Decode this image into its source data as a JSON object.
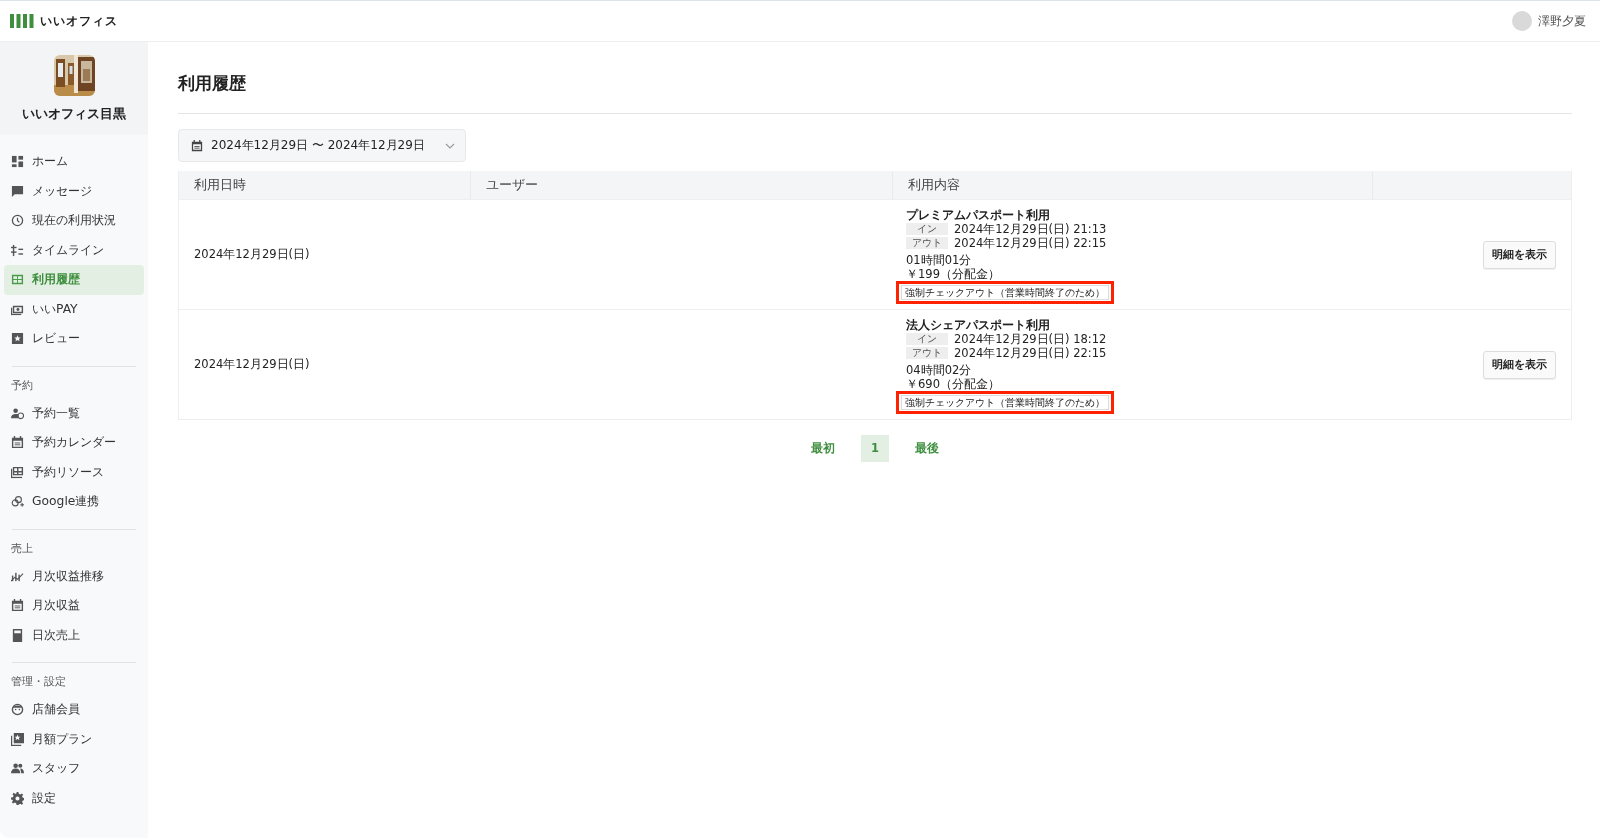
{
  "app": {
    "name": "いいオフィス"
  },
  "user": {
    "name": "澤野夕夏"
  },
  "store": {
    "name": "いいオフィス目黒"
  },
  "sidebar": {
    "sections": [
      {
        "items": [
          {
            "label": "ホーム",
            "selected": false
          },
          {
            "label": "メッセージ",
            "selected": false
          },
          {
            "label": "現在の利用状況",
            "selected": false
          },
          {
            "label": "タイムライン",
            "selected": false
          },
          {
            "label": "利用履歴",
            "selected": true
          },
          {
            "label": "いいPAY",
            "selected": false
          },
          {
            "label": "レビュー",
            "selected": false
          }
        ]
      },
      {
        "heading": "予約",
        "items": [
          {
            "label": "予約一覧",
            "selected": false
          },
          {
            "label": "予約カレンダー",
            "selected": false
          },
          {
            "label": "予約リソース",
            "selected": false
          },
          {
            "label": "Google連携",
            "selected": false
          }
        ]
      },
      {
        "heading": "売上",
        "items": [
          {
            "label": "月次収益推移",
            "selected": false
          },
          {
            "label": "月次収益",
            "selected": false
          },
          {
            "label": "日次売上",
            "selected": false
          }
        ]
      },
      {
        "heading": "管理・設定",
        "items": [
          {
            "label": "店舗会員",
            "selected": false
          },
          {
            "label": "月額プラン",
            "selected": false
          },
          {
            "label": "スタッフ",
            "selected": false
          },
          {
            "label": "設定",
            "selected": false
          }
        ]
      }
    ]
  },
  "page": {
    "title": "利用履歴"
  },
  "date_filter": {
    "value": "2024年12月29日 〜 2024年12月29日"
  },
  "table": {
    "columns": [
      "利用日時",
      "ユーザー",
      "利用内容"
    ],
    "rows": [
      {
        "date": "2024年12月29日(日)",
        "plan": "プレミアムパスポート利用",
        "in_label": "イン",
        "in_time": "2024年12月29日(日) 21:13",
        "out_label": "アウト",
        "out_time": "2024年12月29日(日) 22:15",
        "duration": "01時間01分",
        "amount": "￥199（分配金）",
        "notice": "強制チェックアウト（営業時間終了のため）",
        "highlighted": true,
        "button": "明細を表示"
      },
      {
        "date": "2024年12月29日(日)",
        "plan": "法人シェアパスポート利用",
        "in_label": "イン",
        "in_time": "2024年12月29日(日) 18:12",
        "out_label": "アウト",
        "out_time": "2024年12月29日(日) 22:15",
        "duration": "04時間02分",
        "amount": "￥690（分配金）",
        "notice": "強制チェックアウト（営業時間終了のため）",
        "highlighted": true,
        "button": "明細を表示"
      }
    ]
  },
  "pagination": [
    {
      "label": "最初",
      "selected": false
    },
    {
      "label": "1",
      "selected": true
    },
    {
      "label": "最後",
      "selected": false
    }
  ]
}
